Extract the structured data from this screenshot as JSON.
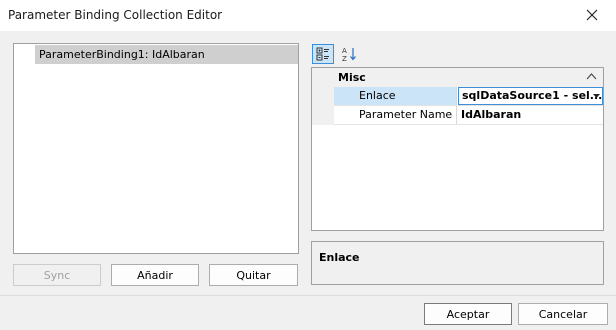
{
  "window": {
    "title": "Parameter Binding Collection Editor"
  },
  "list": {
    "items": [
      {
        "label": "ParameterBinding1: IdAlbaran"
      }
    ]
  },
  "left_buttons": {
    "sync": "Sync",
    "add": "Añadir",
    "remove": "Quitar"
  },
  "toolbar": {
    "categorized_icon": "categorized-icon",
    "alphabetical_icon": "alphabetical-sort-icon"
  },
  "property_grid": {
    "category": "Misc",
    "rows": [
      {
        "name": "Enlace",
        "value": "sqlDataSource1 - sel..."
      },
      {
        "name": "Parameter Name",
        "value": "IdAlbaran"
      }
    ]
  },
  "description": {
    "title": "Enlace"
  },
  "footer": {
    "accept": "Aceptar",
    "cancel": "Cancelar"
  },
  "colors": {
    "selection": "#cce4f7",
    "accent": "#3c8fd6",
    "list_selected": "#cfcfcf"
  }
}
